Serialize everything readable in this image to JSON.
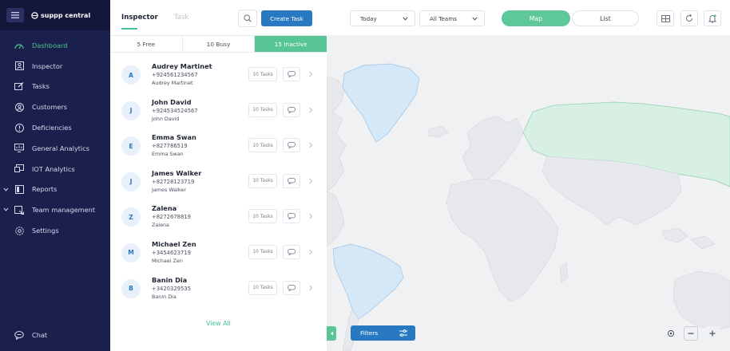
{
  "brand": {
    "name": "suppp central"
  },
  "nav": [
    {
      "label": "Dashboard",
      "icon": "dashboard-icon",
      "active": true
    },
    {
      "label": "Inspector",
      "icon": "inspector-icon"
    },
    {
      "label": "Tasks",
      "icon": "tasks-icon"
    },
    {
      "label": "Customers",
      "icon": "customers-icon"
    },
    {
      "label": "Deficiencies",
      "icon": "deficiencies-icon"
    },
    {
      "label": "General Analytics",
      "icon": "analytics-icon"
    },
    {
      "label": "IOT Analytics",
      "icon": "iot-icon"
    },
    {
      "label": "Reports",
      "icon": "reports-icon",
      "expandable": true
    },
    {
      "label": "Team management",
      "icon": "team-icon",
      "expandable": true
    },
    {
      "label": "Settings",
      "icon": "settings-icon"
    }
  ],
  "chat_label": "Chat",
  "panel": {
    "tabs": [
      "Inspector",
      "Task"
    ],
    "create_task": "Create Task",
    "filters": [
      "5 Free",
      "10 Busy",
      "15 Inactive"
    ],
    "view_all": "View All",
    "people": [
      {
        "initial": "A",
        "name": "Audrey Martinet",
        "phone": "+924561234567",
        "sub": "Audrey Martinet",
        "tasks": "10 Tasks"
      },
      {
        "initial": "J",
        "name": "John David",
        "phone": "+924534524567",
        "sub": "John David",
        "tasks": "10 Tasks"
      },
      {
        "initial": "E",
        "name": "Emma Swan",
        "phone": "+827786519",
        "sub": "Emma Swan",
        "tasks": "10 Tasks"
      },
      {
        "initial": "J",
        "name": "James Walker",
        "phone": "+82728123719",
        "sub": "James Walker",
        "tasks": "10 Tasks"
      },
      {
        "initial": "Z",
        "name": "Zalena",
        "phone": "+8272678819",
        "sub": "Zalena",
        "tasks": "10 Tasks"
      },
      {
        "initial": "M",
        "name": "Michael Zen",
        "phone": "+3454623719",
        "sub": "Michael Zen",
        "tasks": "10 Tasks"
      },
      {
        "initial": "B",
        "name": "Banin Dia",
        "phone": "+3420329535",
        "sub": "Banin Dia",
        "tasks": "10 Tasks"
      }
    ]
  },
  "toolbar": {
    "date_select": "Today",
    "team_select": "All Teams",
    "map_label": "Map",
    "list_label": "List",
    "filters_label": "Filters"
  },
  "colors": {
    "sidebar_bg": "#1b1f4b",
    "accent_green": "#47c393",
    "primary_blue": "#2979c2",
    "map_blue": "#d4e8f8",
    "map_green": "#d7f0e3"
  }
}
